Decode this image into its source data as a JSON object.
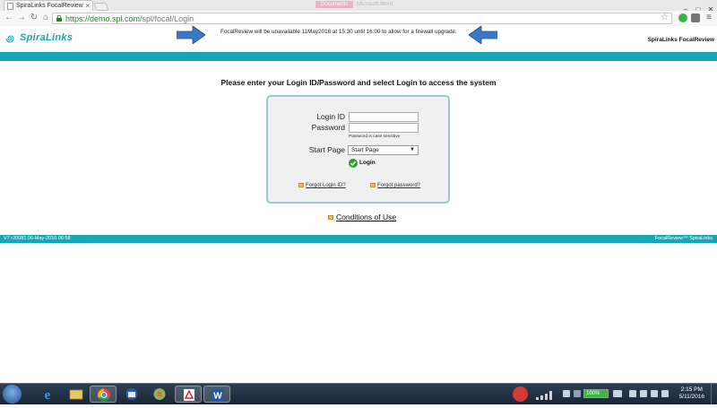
{
  "browser": {
    "tab_title": "SpiraLinks FocalReview",
    "tab_close": "×",
    "faded_tabs": [
      "Documents",
      "Microsoft Word"
    ],
    "url_host": "https://demo.spl.com",
    "url_path": "/spl/focal/Login",
    "window_controls": [
      "–",
      "□",
      "✕"
    ],
    "icons": [
      "back-icon",
      "forward-icon",
      "reload-icon",
      "lock-icon",
      "star-icon",
      "menu-icon"
    ]
  },
  "header": {
    "logo_text": "SpiraLinks",
    "notice": "FocalReview will be unavailable 11May2016 at 15:30 until 16:00 to allow for a firewall upgrade.",
    "brand_right": "SpiraLinks FocalReview"
  },
  "login": {
    "prompt": "Please enter your Login ID/Password and select Login to access the system",
    "login_id_label": "Login ID",
    "login_id_value": "",
    "password_label": "Password",
    "password_value": "",
    "password_hint": "Password is case sensitive",
    "start_page_label": "Start Page",
    "start_page_selected": "Start Page",
    "login_button": "Login",
    "forgot_login": "Forgot Login ID?",
    "forgot_password": "Forgot password?"
  },
  "conditions_link": "Conditions of Use",
  "footer": {
    "left": "V7 r20081 06-May-2016 06:58",
    "right": "FocalReview™ SpiraLinks"
  },
  "taskbar": {
    "battery_label": "100%",
    "battery_fraction": 1.0,
    "time": "2:15 PM",
    "date": "5/11/2016",
    "apps": [
      "windows-start-icon",
      "internet-explorer-icon",
      "file-explorer-icon",
      "chrome-icon",
      "thunderbird-icon",
      "app-icon",
      "acrobat-icon",
      "word-icon"
    ]
  },
  "colors": {
    "teal": "#16a7b7",
    "arrow_blue": "#3a78c4"
  }
}
